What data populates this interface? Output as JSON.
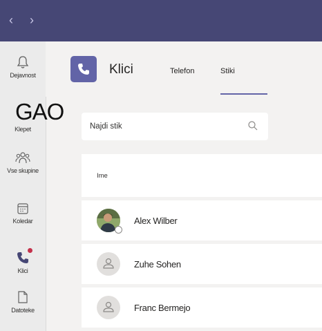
{
  "titlebar": {
    "back_glyph": "‹",
    "forward_glyph": "›"
  },
  "rail": {
    "items": [
      {
        "label": "Dejavnost",
        "icon": "bell-icon"
      },
      {
        "label": "Klepet",
        "icon": "chat-icon"
      },
      {
        "label": "Vse skupine",
        "icon": "teams-icon"
      },
      {
        "label": "Koledar",
        "icon": "calendar-icon"
      },
      {
        "label": "Klici",
        "icon": "phone-icon",
        "active": true,
        "badge": true
      },
      {
        "label": "Datoteke",
        "icon": "file-icon"
      }
    ]
  },
  "watermark": "GAO",
  "header": {
    "title": "Klici",
    "tabs": [
      {
        "label": "Telefon",
        "active": false
      },
      {
        "label": "Stiki",
        "active": true
      }
    ]
  },
  "search": {
    "placeholder": "Najdi stik"
  },
  "contacts": {
    "column_header": "Ime",
    "rows": [
      {
        "name": "Alex Wilber",
        "avatar": "photo",
        "presence": "offline"
      },
      {
        "name": "Zuhe Sohen",
        "avatar": "placeholder-person-icon"
      },
      {
        "name": "Franc Bermejo",
        "avatar": "placeholder-person-icon"
      }
    ]
  },
  "colors": {
    "titlebar": "#464775",
    "accent": "#6264a7",
    "badge": "#c4314b",
    "background": "#f3f2f1"
  }
}
